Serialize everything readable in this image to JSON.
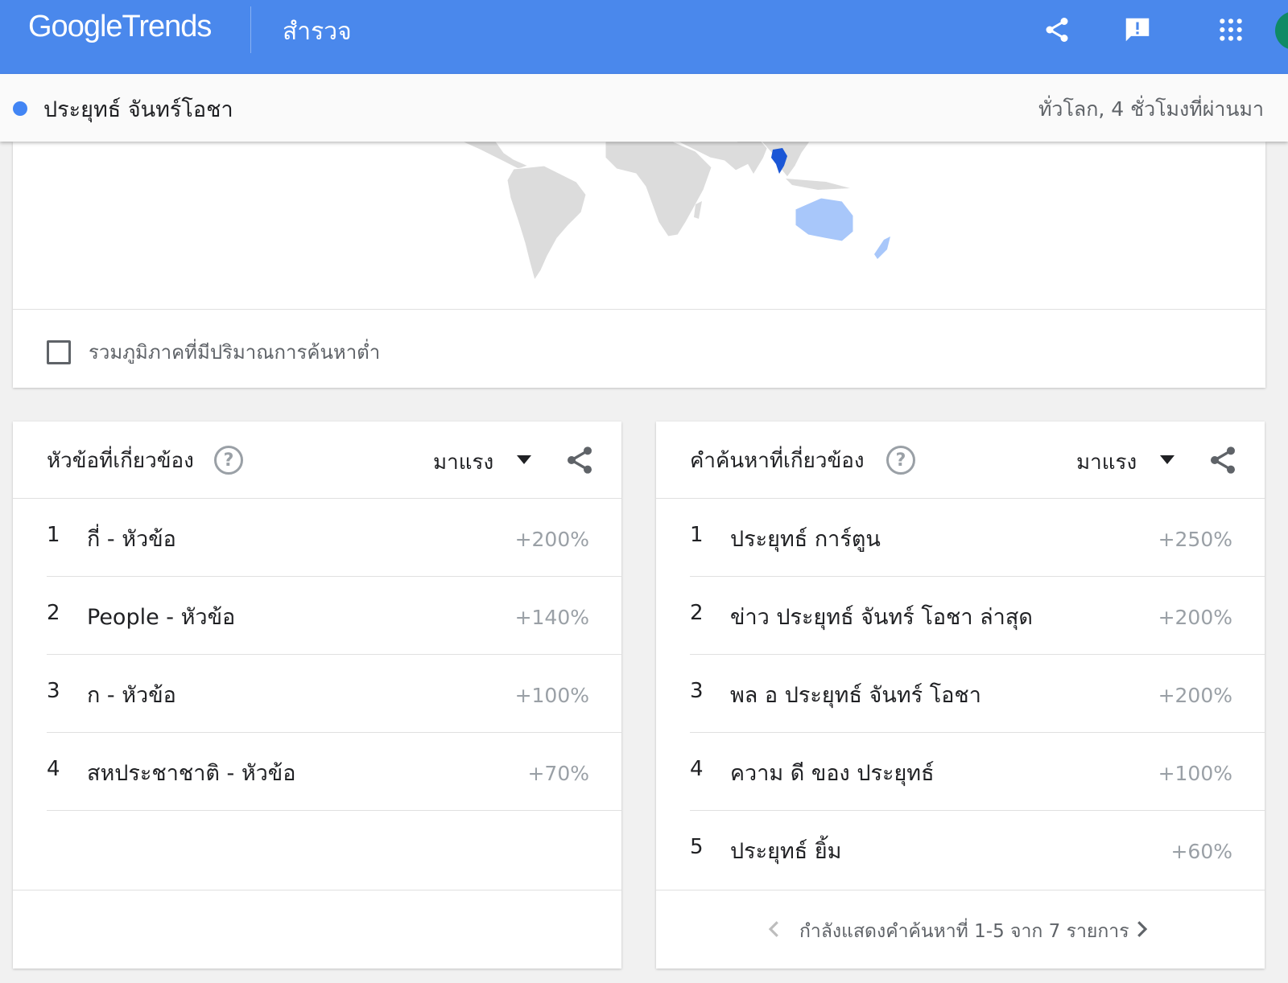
{
  "app": {
    "logo_google": "Google",
    "logo_trends": "Trends",
    "nav_explore": "สำรวจ"
  },
  "icons": {
    "share": "share-icon",
    "feedback": "feedback-icon",
    "apps": "apps-grid-icon",
    "help": "help-circle-icon",
    "dropdown": "dropdown-arrow-icon",
    "prev": "chevron-left-icon",
    "next": "chevron-right-icon"
  },
  "colors": {
    "appbar": "#4a88ec",
    "term_dot": "#4285f4",
    "map_highlight": "#1a56d6",
    "map_light": "#a8c7fa"
  },
  "term": {
    "label": "ประยุทธ์ จันทร์โอชา",
    "scope": "ทั่วโลก, 4 ชั่วโมงที่ผ่านมา"
  },
  "map": {
    "low_volume_label": "รวมภูมิภาคที่มีปริมาณการค้นหาต่ำ",
    "low_volume_checked": false
  },
  "related_topics": {
    "title": "หัวข้อที่เกี่ยวข้อง",
    "sort_label": "มาแรง",
    "rows": [
      {
        "rank": "1",
        "label": "กี่ - หัวข้อ",
        "value": "+200%"
      },
      {
        "rank": "2",
        "label": "People - หัวข้อ",
        "value": "+140%"
      },
      {
        "rank": "3",
        "label": "ก - หัวข้อ",
        "value": "+100%"
      },
      {
        "rank": "4",
        "label": "สหประชาชาติ - หัวข้อ",
        "value": "+70%"
      }
    ]
  },
  "related_queries": {
    "title": "คำค้นหาที่เกี่ยวข้อง",
    "sort_label": "มาแรง",
    "rows": [
      {
        "rank": "1",
        "label": "ประยุทธ์ การ์ตูน",
        "value": "+250%"
      },
      {
        "rank": "2",
        "label": "ข่าว ประยุทธ์ จันทร์ โอชา ล่าสุด",
        "value": "+200%"
      },
      {
        "rank": "3",
        "label": "พล อ ประยุทธ์ จันทร์ โอชา",
        "value": "+200%"
      },
      {
        "rank": "4",
        "label": "ความ ดี ของ ประยุทธ์",
        "value": "+100%"
      },
      {
        "rank": "5",
        "label": "ประยุทธ์ ยิ้ม",
        "value": "+60%"
      }
    ],
    "pager_text": "กำลังแสดงคำค้นหาที่ 1-5 จาก 7 รายการ"
  }
}
